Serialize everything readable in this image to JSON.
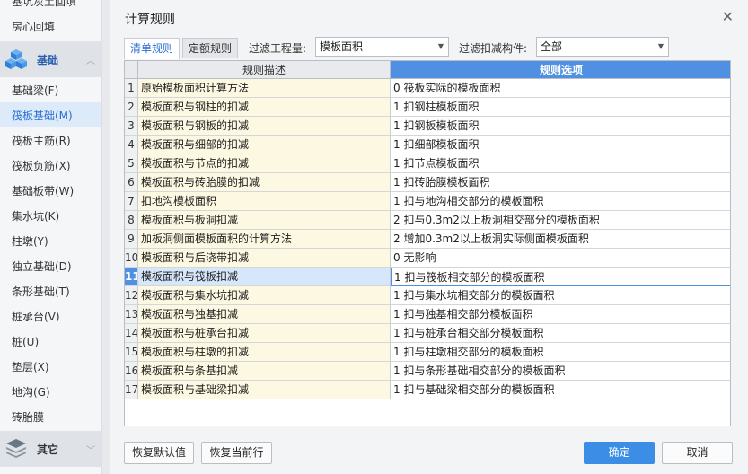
{
  "sidebar": {
    "top_items": [
      "基坑灰土回填",
      "房心回填"
    ],
    "group_label": "基础",
    "items": [
      "基础梁(F)",
      "筏板基础(M)",
      "筏板主筋(R)",
      "筏板负筋(X)",
      "基础板带(W)",
      "集水坑(K)",
      "柱墩(Y)",
      "独立基础(D)",
      "条形基础(T)",
      "桩承台(V)",
      "桩(U)",
      "垫层(X)",
      "地沟(G)",
      "砖胎膜"
    ],
    "selected_item": "筏板基础(M)",
    "bottom_group_label": "其它"
  },
  "dialog": {
    "title": "计算规则",
    "tabs": [
      "清单规则",
      "定额规则"
    ],
    "filter_project_label": "过滤工程量:",
    "filter_project_value": "模板面积",
    "filter_member_label": "过滤扣减构件:",
    "filter_member_value": "全部",
    "table": {
      "headers": [
        "规则描述",
        "规则选项"
      ],
      "rows": [
        {
          "num": "1",
          "desc": "原始模板面积计算方法",
          "option": "0  筏板实际的模板面积"
        },
        {
          "num": "2",
          "desc": "模板面积与钢柱的扣减",
          "option": "1 扣钢柱模板面积"
        },
        {
          "num": "3",
          "desc": "模板面积与钢板的扣减",
          "option": "1 扣钢板模板面积"
        },
        {
          "num": "4",
          "desc": "模板面积与细部的扣减",
          "option": "1 扣细部模板面积"
        },
        {
          "num": "5",
          "desc": "模板面积与节点的扣减",
          "option": "1 扣节点模板面积"
        },
        {
          "num": "6",
          "desc": "模板面积与砖胎膜的扣减",
          "option": "1 扣砖胎膜模板面积"
        },
        {
          "num": "7",
          "desc": "扣地沟模板面积",
          "option": "1 扣与地沟相交部分的模板面积"
        },
        {
          "num": "8",
          "desc": "模板面积与板洞扣减",
          "option": "2 扣与0.3m2以上板洞相交部分的模板面积"
        },
        {
          "num": "9",
          "desc": "加板洞侧面模板面积的计算方法",
          "option": "2 增加0.3m2以上板洞实际侧面模板面积"
        },
        {
          "num": "10",
          "desc": "模板面积与后浇带扣减",
          "option": "0  无影响"
        },
        {
          "num": "11",
          "desc": "模板面积与筏板扣减",
          "option": "1 扣与筏板相交部分的模板面积"
        },
        {
          "num": "12",
          "desc": "模板面积与集水坑扣减",
          "option": "1 扣与集水坑相交部分的模板面积"
        },
        {
          "num": "13",
          "desc": "模板面积与独基扣减",
          "option": "1  扣与独基相交部分模板面积"
        },
        {
          "num": "14",
          "desc": "模板面积与桩承台扣减",
          "option": "1  扣与桩承台相交部分模板面积"
        },
        {
          "num": "15",
          "desc": "模板面积与柱墩的扣减",
          "option": "1 扣与柱墩相交部分的模板面积"
        },
        {
          "num": "16",
          "desc": "模板面积与条基扣减",
          "option": "1 扣与条形基础相交部分的模板面积"
        },
        {
          "num": "17",
          "desc": "模板面积与基础梁扣减",
          "option": "1 扣与基础梁相交部分的模板面积"
        }
      ],
      "selected_row": "11"
    },
    "buttons": {
      "restore_default": "恢复默认值",
      "restore_current": "恢复当前行",
      "ok": "确定",
      "cancel": "取消"
    }
  },
  "icons": {
    "foundation_group": "cubes-icon",
    "other_group": "layers-icon",
    "close": "close-icon",
    "dropdown": "chevron-down-icon"
  },
  "colors": {
    "accent": "#4f90e3",
    "primary_button": "#3c8de6",
    "desc_cell_bg": "#fdf8e1"
  }
}
